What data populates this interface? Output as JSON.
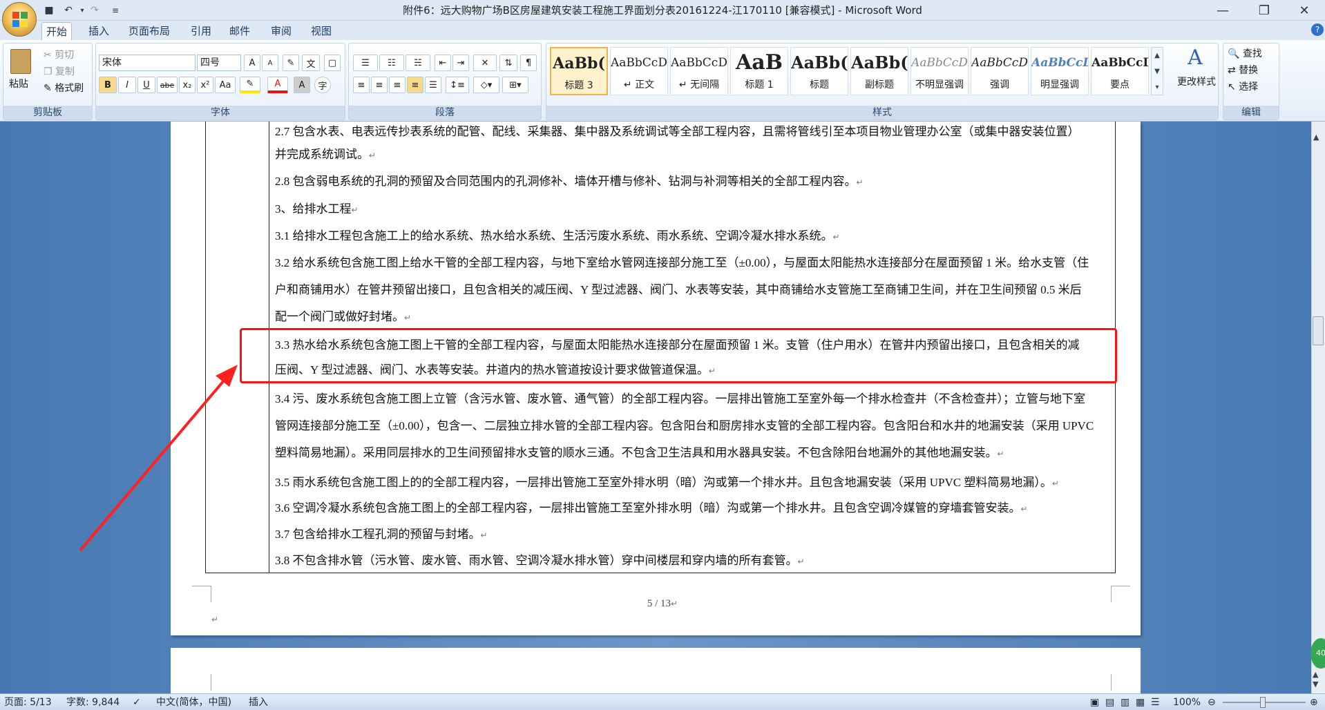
{
  "window": {
    "title": "附件6：远大购物广场B区房屋建筑安装工程施工界面划分表20161224-江170110 [兼容模式] - Microsoft Word"
  },
  "tabs": [
    "开始",
    "插入",
    "页面布局",
    "引用",
    "邮件",
    "审阅",
    "视图"
  ],
  "clipboard": {
    "paste": "粘贴",
    "cut": "剪切",
    "copy": "复制",
    "format_painter": "格式刷",
    "label": "剪贴板"
  },
  "font": {
    "name": "宋体",
    "size": "四号",
    "label": "字体",
    "grow": "A",
    "shrink": "A",
    "bold": "B",
    "italic": "I",
    "underline": "U",
    "strike": "abe",
    "sub": "x₂",
    "sup": "x²",
    "case": "Aa",
    "color_a": "A"
  },
  "paragraph": {
    "label": "段落"
  },
  "styles": {
    "label": "样式",
    "items": [
      {
        "preview": "AaBb(",
        "name": "标题 3"
      },
      {
        "preview": "AaBbCcD",
        "name": "↵ 正文"
      },
      {
        "preview": "AaBbCcD",
        "name": "↵ 无间隔"
      },
      {
        "preview": "AaB",
        "name": "标题 1"
      },
      {
        "preview": "AaBb(",
        "name": "标题"
      },
      {
        "preview": "AaBb(",
        "name": "副标题"
      },
      {
        "preview": "AaBbCcD",
        "name": "不明显强调"
      },
      {
        "preview": "AaBbCcD",
        "name": "强调"
      },
      {
        "preview": "AaBbCcD",
        "name": "明显强调"
      },
      {
        "preview": "AaBbCcD",
        "name": "要点"
      }
    ],
    "change_styles": "更改样式"
  },
  "editing": {
    "find": "查找",
    "replace": "替换",
    "select": "选择",
    "label": "编辑"
  },
  "document": {
    "lines": [
      "2.7 包含水表、电表远传抄表系统的配管、配线、采集器、集中器及系统调试等全部工程内容，且需将管线引至本项目物业管理办公室（或集中器安装位置）",
      "并完成系统调试。",
      "2.8 包含弱电系统的孔洞的预留及合同范围内的孔洞修补、墙体开槽与修补、钻洞与补洞等相关的全部工程内容。",
      "3、给排水工程",
      "3.1 给排水工程包含施工上的给水系统、热水给水系统、生活污废水系统、雨水系统、空调冷凝水排水系统。",
      "3.2 给水系统包含施工图上给水干管的全部工程内容，与地下室给水管网连接部分施工至（±0.00），与屋面太阳能热水连接部分在屋面预留 1 米。给水支管（住",
      "户和商铺用水）在管井预留出接口，且包含相关的减压阀、Y 型过滤器、阀门、水表等安装，其中商铺给水支管施工至商铺卫生间，并在卫生间预留 0.5 米后",
      "配一个阀门或做好封堵。",
      "3.3 热水给水系统包含施工图上干管的全部工程内容，与屋面太阳能热水连接部分在屋面预留 1 米。支管（住户用水）在管井内预留出接口，且包含相关的减",
      "压阀、Y 型过滤器、阀门、水表等安装。井道内的热水管道按设计要求做管道保温。",
      "3.4 污、废水系统包含施工图上立管（含污水管、废水管、通气管）的全部工程内容。一层排出管施工至室外每一个排水检查井（不含检查井）；立管与地下室",
      "管网连接部分施工至（±0.00），包含一、二层独立排水管的全部工程内容。包含阳台和厨房排水支管的全部工程内容。包含阳台和水井的地漏安装（采用 UPVC",
      "塑料简易地漏）。采用同层排水的卫生间预留排水支管的顺水三通。不包含卫生洁具和用水器具安装。不包含除阳台地漏外的其他地漏安装。",
      "3.5 雨水系统包含施工图上的的全部工程内容，一层排出管施工至室外排水明（暗）沟或第一个排水井。且包含地漏安装（采用 UPVC 塑料简易地漏）。",
      "3.6 空调冷凝水系统包含施工图上的全部工程内容，一层排出管施工至室外排水明（暗）沟或第一个排水井。且包含空调冷媒管的穿墙套管安装。",
      "3.7 包含给排水工程孔洞的预留与封堵。",
      "3.8 不包含排水管（污水管、废水管、雨水管、空调冷凝水排水管）穿中间楼层和穿内墙的所有套管。"
    ],
    "para_mark": "↵",
    "page_footer": "5 / 13"
  },
  "status": {
    "page": "页面: 5/13",
    "words": "字数: 9,844",
    "lang": "中文(简体，中国)",
    "mode": "插入",
    "zoom": "100%",
    "badge": "40"
  },
  "colors": {
    "highlight_box": "#ff1111",
    "arrow": "#ff2020"
  }
}
